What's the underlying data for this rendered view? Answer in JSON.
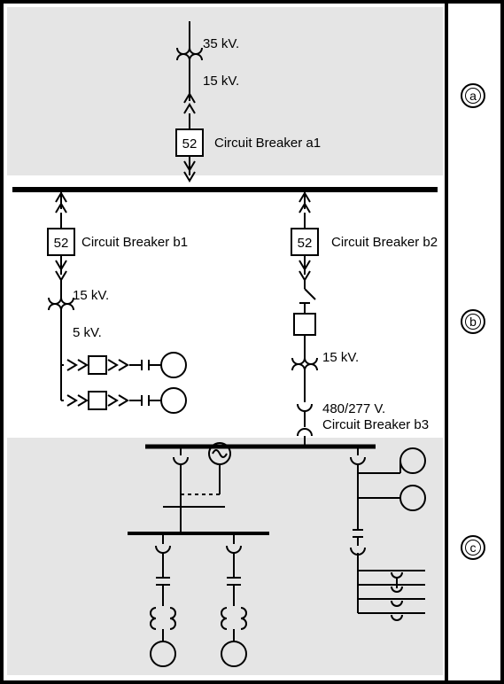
{
  "zones": {
    "a": "a",
    "b": "b",
    "c": "c"
  },
  "transformer_a": {
    "primary": "35 kV.",
    "secondary": "15 kV."
  },
  "breaker_a1": {
    "code": "52",
    "label": "Circuit Breaker a1"
  },
  "breaker_b1": {
    "code": "52",
    "label": "Circuit Breaker b1"
  },
  "breaker_b2": {
    "code": "52",
    "label": "Circuit Breaker b2"
  },
  "transformer_b1": {
    "primary": "15 kV.",
    "secondary": "5 kV."
  },
  "transformer_b2": {
    "primary": "15 kV.",
    "secondary": "480/277 V."
  },
  "breaker_b3": {
    "label": "Circuit Breaker b3"
  },
  "chart_data": null
}
